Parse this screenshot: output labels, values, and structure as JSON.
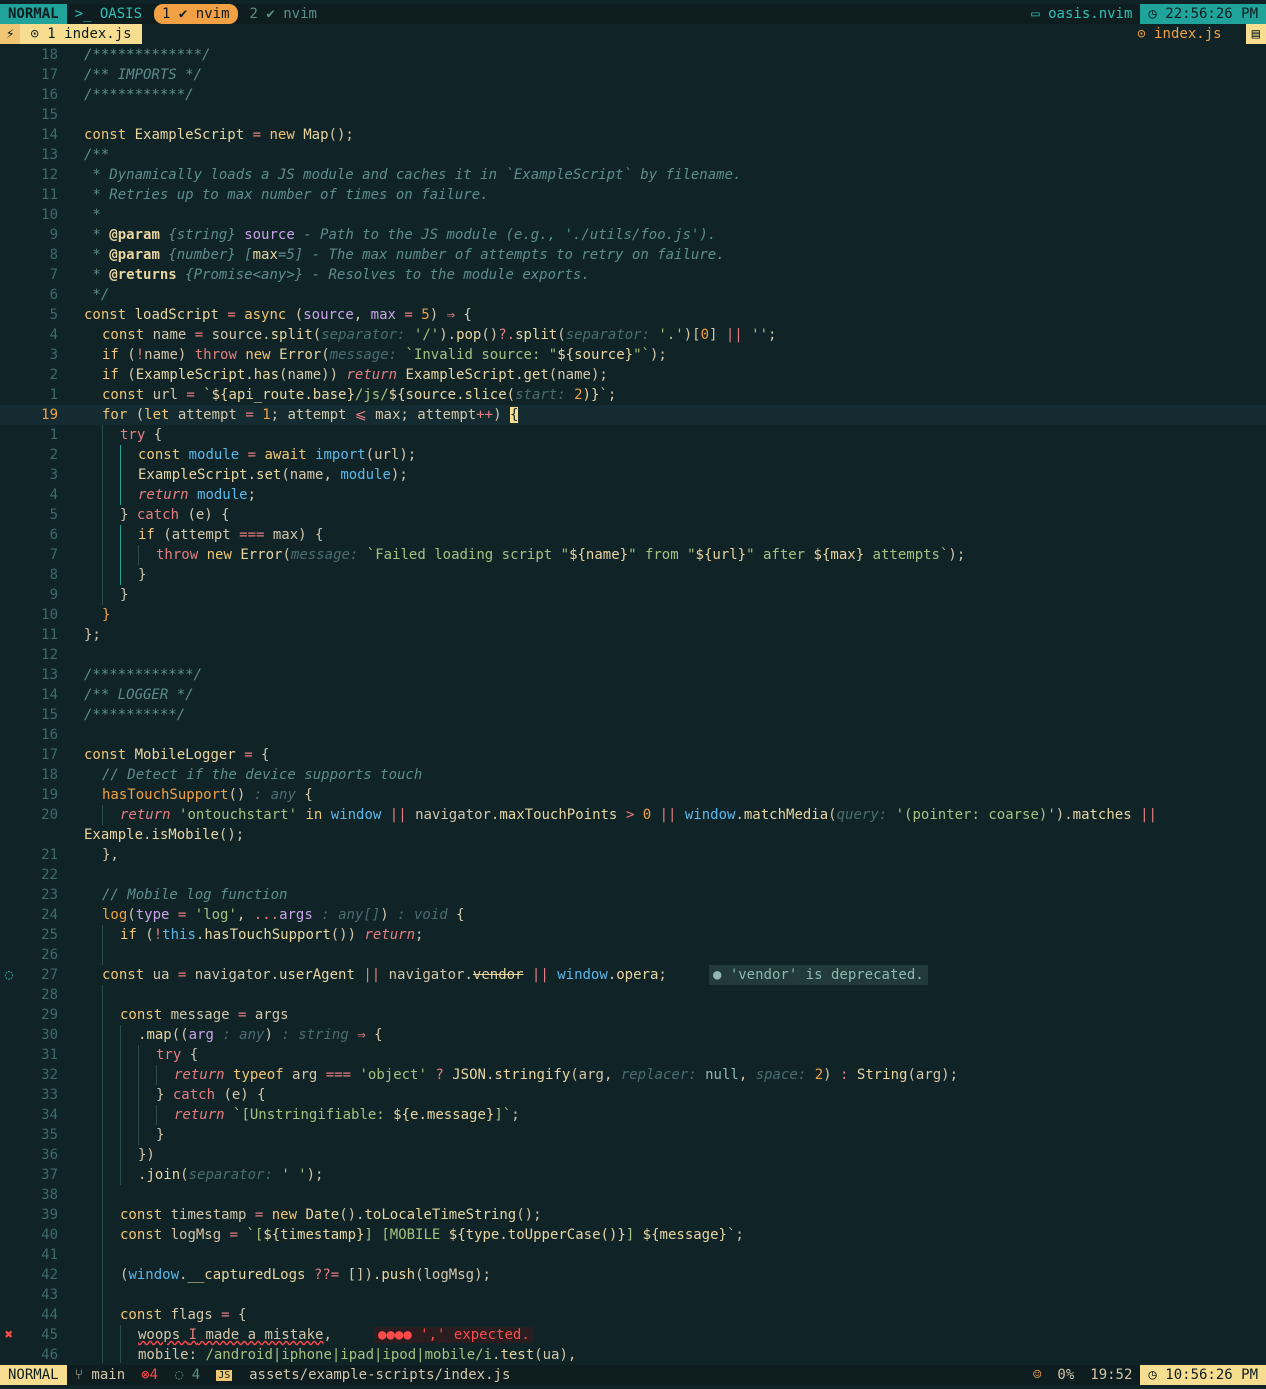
{
  "tabline": {
    "mode": "NORMAL",
    "project": "OASIS",
    "tabs": [
      {
        "index": "1",
        "icon": "vim-icon",
        "label": "nvim",
        "active": true
      },
      {
        "index": "2",
        "icon": "vim-icon",
        "label": "nvim",
        "active": false
      }
    ],
    "cwd": "oasis.nvim",
    "clock": "22:56:26 PM"
  },
  "winbar": {
    "buffer_label": "1 index.js",
    "right_label": "index.js"
  },
  "statusline": {
    "mode": "NORMAL",
    "branch": "main",
    "errors": "4",
    "hints": "4",
    "file": "assets/example-scripts/index.js",
    "percent": "0%",
    "position": "19:52",
    "clock": "10:56:26 PM"
  },
  "editor": {
    "cursor_line": 19,
    "lines": [
      {
        "n": "18",
        "html": "<span class='cm'>/*************/</span>"
      },
      {
        "n": "17",
        "html": "<span class='cm'>/** IMPORTS */</span>"
      },
      {
        "n": "16",
        "html": "<span class='cm'>/***********/</span>"
      },
      {
        "n": "15",
        "html": ""
      },
      {
        "n": "14",
        "html": "<span class='kw'>const</span> <span class='fn'>ExampleScript</span> <span class='op'>=</span> <span class='kw'>new</span> <span class='fn'>Map</span>();"
      },
      {
        "n": "13",
        "html": "<span class='cm'>/**</span>"
      },
      {
        "n": "12",
        "html": "<span class='cm'> * Dynamically loads a JS module and caches it in `ExampleScript` by filename.</span>"
      },
      {
        "n": "11",
        "html": "<span class='cm'> * Retries up to max number of times on failure.</span>"
      },
      {
        "n": "10",
        "html": "<span class='cm'> *</span>"
      },
      {
        "n": "9",
        "html": "<span class='cm'> * </span><span class='doc'>@param</span> <span class='cm'>{string}</span> <span class='prop'>source</span> <span class='cm'>- Path to the JS module (e.g., './utils/foo.js').</span>"
      },
      {
        "n": "8",
        "html": "<span class='cm'> * </span><span class='doc'>@param</span> <span class='cm'>{number} [</span><span class='fn'>max</span><span class='cm'>=5] - The max number of attempts to retry on failure.</span>"
      },
      {
        "n": "7",
        "html": "<span class='cm'> * </span><span class='doc'>@returns</span> <span class='cm'>{Promise&lt;any&gt;} - Resolves to the module exports.</span>"
      },
      {
        "n": "6",
        "html": "<span class='cm'> */</span>"
      },
      {
        "n": "5",
        "html": "<span class='kw'>const</span> <span class='fn'>loadScript</span> <span class='op'>=</span> <span class='kw'>async</span> (<span class='prop'>source</span>, <span class='prop'>max</span> <span class='op'>=</span> <span class='num'>5</span>) <span class='op'>⇒</span> {"
      },
      {
        "n": "4",
        "i": 1,
        "html": "<span class='kw'>const</span> name <span class='op'>=</span> source.<span class='fn'>split</span>(<span class='hint'>separator: </span><span class='str'>'/'</span>).<span class='fn'>pop</span>()<span class='op'>?.</span><span class='fn'>split</span>(<span class='hint'>separator: </span><span class='str'>'.'</span>)[<span class='num'>0</span>] <span class='op'>||</span> <span class='str'>''</span>;"
      },
      {
        "n": "3",
        "i": 1,
        "html": "<span class='kw'>if</span> (<span class='op'>!</span>name) <span class='red'>throw</span> <span class='kw'>new</span> <span class='fn'>Error</span>(<span class='hint'>message: </span><span class='str'>`Invalid source: \"</span><span class='fn'>${source}</span><span class='str'>\"`</span>);"
      },
      {
        "n": "2",
        "i": 1,
        "html": "<span class='kw'>if</span> (<span class='fn'>ExampleScript</span>.<span class='fn'>has</span>(name)) <span class='red' style='font-style:italic'>return</span> <span class='fn'>ExampleScript</span>.<span class='fn'>get</span>(name);"
      },
      {
        "n": "1",
        "i": 1,
        "html": "<span class='kw'>const</span> url <span class='op'>=</span> <span class='str'>`</span><span class='fn'>${api_route.base}</span><span class='str'>/js/</span><span class='fn'>${source.<span class='fn'>slice</span>(<span class='hint'>start: </span><span class='num'>2</span>)}</span><span class='str'>`</span>;"
      },
      {
        "n": "19",
        "cur": true,
        "i": 1,
        "html": "<span class='kw'>for</span> (<span class='kw'>let</span> attempt <span class='op'>=</span> <span class='num'>1</span>; attempt <span class='op'>⩽</span> max; attempt<span class='op'>++</span>) <span class='cursor'>{</span>"
      },
      {
        "n": "1",
        "i": 2,
        "html": "<span class='red'>try</span> {"
      },
      {
        "n": "2",
        "i": 3,
        "a": 2,
        "html": "<span class='kw'>const</span> <span class='glb'>module</span> <span class='op'>=</span> <span class='kw'>await</span> <span class='glb'>import</span>(url);"
      },
      {
        "n": "3",
        "i": 3,
        "a": 2,
        "html": "<span class='fn'>ExampleScript</span>.<span class='fn'>set</span>(name, <span class='glb'>module</span>);"
      },
      {
        "n": "4",
        "i": 3,
        "a": 2,
        "html": "<span class='red' style='font-style:italic'>return</span> <span class='glb'>module</span>;"
      },
      {
        "n": "5",
        "i": 2,
        "html": "} <span class='red'>catch</span> (e) {"
      },
      {
        "n": "6",
        "i": 3,
        "a": 2,
        "html": "<span class='kw'>if</span> (attempt <span class='op'>===</span> max) {"
      },
      {
        "n": "7",
        "i": 4,
        "a": 2,
        "html": "<span class='red'>throw</span> <span class='kw'>new</span> <span class='fn'>Error</span>(<span class='hint'>message: </span><span class='str'>`Failed loading script \"</span><span class='fn'>${name}</span><span class='str'>\" from \"</span><span class='fn'>${url}</span><span class='str'>\" after </span><span class='fn'>${max}</span><span class='str'> attempts`</span>);"
      },
      {
        "n": "8",
        "i": 3,
        "a": 2,
        "html": "}"
      },
      {
        "n": "9",
        "i": 2,
        "a": 2,
        "html": "}"
      },
      {
        "n": "10",
        "i": 1,
        "html": "<span class='num'>}</span>"
      },
      {
        "n": "11",
        "html": "};"
      },
      {
        "n": "12",
        "html": ""
      },
      {
        "n": "13",
        "html": "<span class='cm'>/************/</span>"
      },
      {
        "n": "14",
        "html": "<span class='cm'>/** LOGGER */</span>"
      },
      {
        "n": "15",
        "html": "<span class='cm'>/**********/</span>"
      },
      {
        "n": "16",
        "html": ""
      },
      {
        "n": "17",
        "html": "<span class='kw'>const</span> <span class='fn'>MobileLogger</span> <span class='op'>=</span> {"
      },
      {
        "n": "18",
        "i": 1,
        "html": "<span class='cm'>// Detect if the device supports touch</span>"
      },
      {
        "n": "19",
        "i": 1,
        "html": "<span class='num'>hasTouchSupport</span>() <span class='hint'>: any</span> {"
      },
      {
        "n": "20",
        "i": 2,
        "html": "<span class='red' style='font-style:italic'>return</span> <span class='str'>'ontouchstart'</span> <span class='kw'>in</span> <span class='glb'>window</span> <span class='op'>||</span> navigator.<span class='fn'>maxTouchPoints</span> <span class='op'>&gt;</span> <span class='num'>0</span> <span class='op'>||</span> <span class='glb'>window</span>.<span class='fn'>matchMedia</span>(<span class='hint'>query: </span><span class='str'>'(pointer: coarse)'</span>).<span class='fn'>matches</span> <span class='op'>||</span>"
      },
      {
        "n": "",
        "html": "<span class='fn'>Example</span>.<span class='fn'>isMobile</span>();"
      },
      {
        "n": "21",
        "i": 1,
        "html": "},"
      },
      {
        "n": "22",
        "i": 1,
        "html": ""
      },
      {
        "n": "23",
        "i": 1,
        "html": "<span class='cm'>// Mobile log function</span>"
      },
      {
        "n": "24",
        "i": 1,
        "html": "<span class='num'>log</span>(<span class='prop'>type</span> <span class='op'>=</span> <span class='str'>'log'</span>, <span class='op'>...</span><span class='prop'>args</span> <span class='hint'>: any[]</span>) <span class='hint'>: void</span> {"
      },
      {
        "n": "25",
        "i": 2,
        "html": "<span class='kw'>if</span> (<span class='op'>!</span><span class='glb'>this</span>.<span class='fn'>hasTouchSupport</span>()) <span class='red' style='font-style:italic'>return</span>;"
      },
      {
        "n": "26",
        "i": 2,
        "html": ""
      },
      {
        "n": "27",
        "sign": "bulb",
        "i": 1,
        "html": "<span class='kw'>const</span> ua <span class='op'>=</span> navigator.<span class='fn'>userAgent</span> <span class='op'>||</span> navigator.<span class='fn dep'>vendor</span> <span class='op'>||</span> <span class='glb'>window</span>.<span class='fn'>opera</span>;     <span class='vt'>● 'vendor' is deprecated.</span>"
      },
      {
        "n": "28",
        "i": 2,
        "html": ""
      },
      {
        "n": "29",
        "i": 2,
        "html": "<span class='kw'>const</span> message <span class='op'>=</span> args"
      },
      {
        "n": "30",
        "i": 3,
        "html": ".<span class='fn'>map</span>((<span class='prop'>arg</span> <span class='hint'>: any</span>) <span class='hint'>: string</span> <span class='op'>⇒</span> {"
      },
      {
        "n": "31",
        "i": 4,
        "html": "<span class='red'>try</span> {"
      },
      {
        "n": "32",
        "i": 5,
        "html": "<span class='red' style='font-style:italic'>return</span> <span class='kw'>typeof</span> arg <span class='op'>===</span> <span class='str'>'object'</span> <span class='op'>?</span> <span class='fn'>JSON</span>.<span class='fn'>stringify</span>(arg, <span class='hint'>replacer: </span><span class='typ'>null</span>, <span class='hint'>space: </span><span class='num'>2</span>) <span class='op'>:</span> <span class='fn'>String</span>(arg);"
      },
      {
        "n": "33",
        "i": 4,
        "html": "} <span class='red'>catch</span> (e) {"
      },
      {
        "n": "34",
        "i": 5,
        "html": "<span class='red' style='font-style:italic'>return</span> <span class='str'>`[Unstringifiable: </span><span class='fn'>${e.message}</span><span class='str'>]`</span>;"
      },
      {
        "n": "35",
        "i": 4,
        "html": "}"
      },
      {
        "n": "36",
        "i": 3,
        "html": "})"
      },
      {
        "n": "37",
        "i": 3,
        "html": ".<span class='fn'>join</span>(<span class='hint'>separator: </span><span class='str'>' '</span>);"
      },
      {
        "n": "38",
        "i": 2,
        "html": ""
      },
      {
        "n": "39",
        "i": 2,
        "html": "<span class='kw'>const</span> timestamp <span class='op'>=</span> <span class='kw'>new</span> <span class='fn'>Date</span>().<span class='fn'>toLocaleTimeString</span>();"
      },
      {
        "n": "40",
        "i": 2,
        "html": "<span class='kw'>const</span> logMsg <span class='op'>=</span> <span class='str'>`[</span><span class='fn'>${timestamp}</span><span class='str'>] [MOBILE </span><span class='fn'>${type.<span class='fn'>toUpperCase</span>()}</span><span class='str'>] </span><span class='fn'>${message}</span><span class='str'>`</span>;"
      },
      {
        "n": "41",
        "i": 2,
        "html": ""
      },
      {
        "n": "42",
        "i": 2,
        "html": "(<span class='glb'>window</span>.<span class='fn'>__capturedLogs</span> <span class='op'>??=</span> []).<span class='fn'>push</span>(logMsg);"
      },
      {
        "n": "43",
        "i": 2,
        "html": ""
      },
      {
        "n": "44",
        "i": 2,
        "html": "<span class='kw'>const</span> flags <span class='op'>=</span> {"
      },
      {
        "n": "45",
        "sign": "error",
        "i": 3,
        "html": "<span class='wavy'>woops <span class='red'>I</span> made a mistake</span>,     <span class='vt-err'>●●●● ',' expected.</span>"
      },
      {
        "n": "46",
        "i": 3,
        "html": "mobile: <span class='str'>/android|iphone|ipad|ipod|mobile/i</span>.<span class='fn'>test</span>(ua),"
      }
    ]
  }
}
